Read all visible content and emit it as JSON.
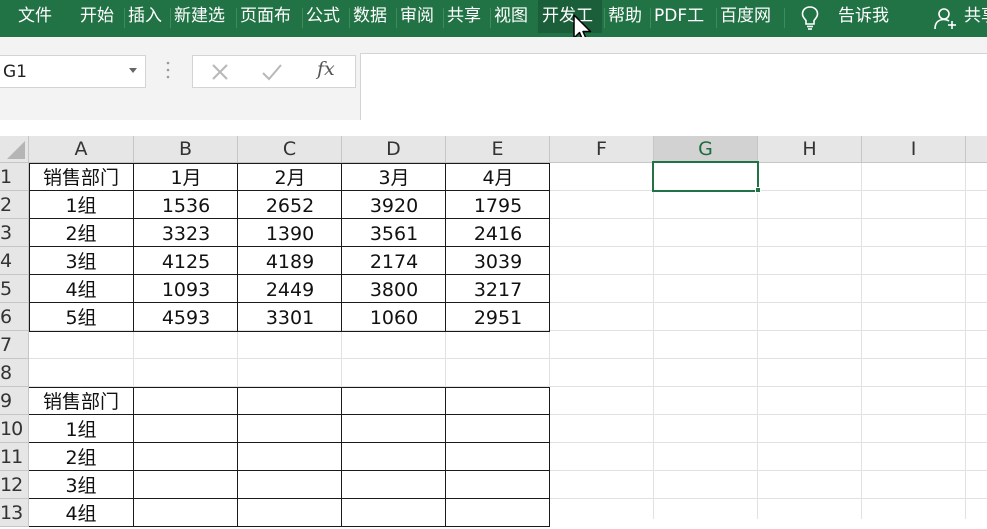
{
  "ribbon": {
    "tabs": [
      "文件",
      "开始",
      "插入",
      "新建选",
      "页面布",
      "公式",
      "数据",
      "审阅",
      "共享",
      "视图",
      "开发工",
      "帮助",
      "PDF工",
      "百度网"
    ],
    "active_tab": "开发工",
    "tell_me": "告诉我",
    "share": "共享",
    "color": "#217346"
  },
  "formula_bar": {
    "name_box": "G1",
    "cancel_icon": "✕",
    "enter_icon": "✓",
    "fx_label": "fx",
    "formula": ""
  },
  "sheet": {
    "columns": [
      "A",
      "B",
      "C",
      "D",
      "E",
      "F",
      "G",
      "H",
      "I"
    ],
    "selected_column": "G",
    "rows": [
      "1",
      "2",
      "3",
      "4",
      "5",
      "6",
      "7",
      "8",
      "9",
      "10",
      "11",
      "12",
      "13"
    ],
    "selected_cell": "G1",
    "table1": {
      "header": [
        "销售部门",
        "1月",
        "2月",
        "3月",
        "4月"
      ],
      "rows": [
        [
          "1组",
          "1536",
          "2652",
          "3920",
          "1795"
        ],
        [
          "2组",
          "3323",
          "1390",
          "3561",
          "2416"
        ],
        [
          "3组",
          "4125",
          "4189",
          "2174",
          "3039"
        ],
        [
          "4组",
          "1093",
          "2449",
          "3800",
          "3217"
        ],
        [
          "5组",
          "4593",
          "3301",
          "1060",
          "2951"
        ]
      ]
    },
    "table2": {
      "header": "销售部门",
      "rows": [
        "1组",
        "2组",
        "3组",
        "4组"
      ]
    }
  }
}
